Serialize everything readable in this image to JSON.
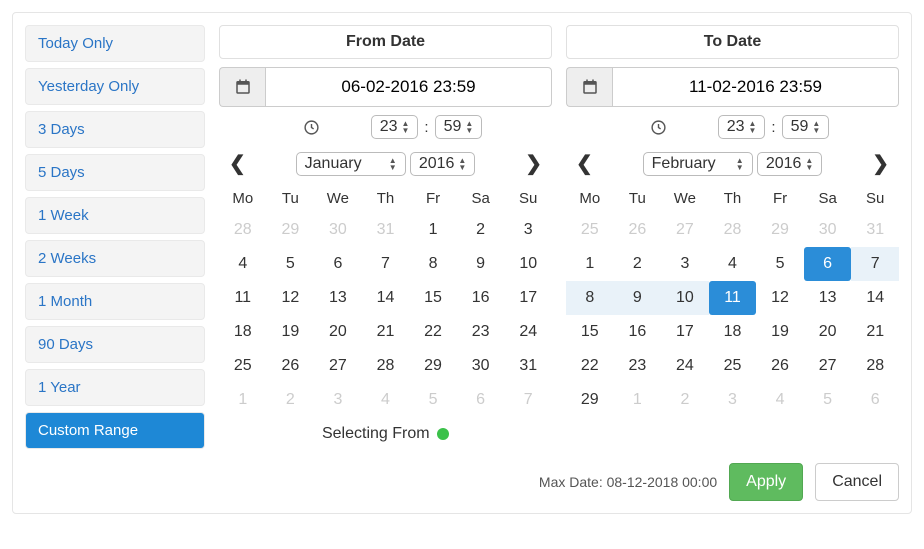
{
  "presets": [
    {
      "label": "Today Only"
    },
    {
      "label": "Yesterday Only"
    },
    {
      "label": "3 Days"
    },
    {
      "label": "5 Days"
    },
    {
      "label": "1 Week"
    },
    {
      "label": "2 Weeks"
    },
    {
      "label": "1 Month"
    },
    {
      "label": "90 Days"
    },
    {
      "label": "1 Year"
    },
    {
      "label": "Custom Range",
      "active": true
    }
  ],
  "from": {
    "title": "From Date",
    "value": "06-02-2016 23:59",
    "hour": "23",
    "minute": "59",
    "month": "January",
    "year": "2016",
    "dow": [
      "Mo",
      "Tu",
      "We",
      "Th",
      "Fr",
      "Sa",
      "Su"
    ],
    "days": [
      {
        "n": 28,
        "m": true
      },
      {
        "n": 29,
        "m": true
      },
      {
        "n": 30,
        "m": true
      },
      {
        "n": 31,
        "m": true
      },
      {
        "n": 1
      },
      {
        "n": 2
      },
      {
        "n": 3
      },
      {
        "n": 4
      },
      {
        "n": 5
      },
      {
        "n": 6
      },
      {
        "n": 7
      },
      {
        "n": 8
      },
      {
        "n": 9
      },
      {
        "n": 10
      },
      {
        "n": 11
      },
      {
        "n": 12
      },
      {
        "n": 13
      },
      {
        "n": 14
      },
      {
        "n": 15
      },
      {
        "n": 16
      },
      {
        "n": 17
      },
      {
        "n": 18
      },
      {
        "n": 19
      },
      {
        "n": 20
      },
      {
        "n": 21
      },
      {
        "n": 22
      },
      {
        "n": 23
      },
      {
        "n": 24
      },
      {
        "n": 25
      },
      {
        "n": 26
      },
      {
        "n": 27
      },
      {
        "n": 28
      },
      {
        "n": 29
      },
      {
        "n": 30
      },
      {
        "n": 31
      },
      {
        "n": 1,
        "m": true
      },
      {
        "n": 2,
        "m": true
      },
      {
        "n": 3,
        "m": true
      },
      {
        "n": 4,
        "m": true
      },
      {
        "n": 5,
        "m": true
      },
      {
        "n": 6,
        "m": true
      },
      {
        "n": 7,
        "m": true
      }
    ]
  },
  "to": {
    "title": "To Date",
    "value": "11-02-2016 23:59",
    "hour": "23",
    "minute": "59",
    "month": "February",
    "year": "2016",
    "dow": [
      "Mo",
      "Tu",
      "We",
      "Th",
      "Fr",
      "Sa",
      "Su"
    ],
    "days": [
      {
        "n": 25,
        "m": true
      },
      {
        "n": 26,
        "m": true
      },
      {
        "n": 27,
        "m": true
      },
      {
        "n": 28,
        "m": true
      },
      {
        "n": 29,
        "m": true
      },
      {
        "n": 30,
        "m": true
      },
      {
        "n": 31,
        "m": true
      },
      {
        "n": 1
      },
      {
        "n": 2
      },
      {
        "n": 3
      },
      {
        "n": 4
      },
      {
        "n": 5
      },
      {
        "n": 6,
        "sel": true
      },
      {
        "n": 7,
        "inr": true
      },
      {
        "n": 8,
        "inr": true
      },
      {
        "n": 9,
        "inr": true
      },
      {
        "n": 10,
        "inr": true
      },
      {
        "n": 11,
        "sel": true
      },
      {
        "n": 12
      },
      {
        "n": 13
      },
      {
        "n": 14
      },
      {
        "n": 15
      },
      {
        "n": 16
      },
      {
        "n": 17
      },
      {
        "n": 18
      },
      {
        "n": 19
      },
      {
        "n": 20
      },
      {
        "n": 21
      },
      {
        "n": 22
      },
      {
        "n": 23
      },
      {
        "n": 24
      },
      {
        "n": 25
      },
      {
        "n": 26
      },
      {
        "n": 27
      },
      {
        "n": 28
      },
      {
        "n": 29
      },
      {
        "n": 1,
        "m": true
      },
      {
        "n": 2,
        "m": true
      },
      {
        "n": 3,
        "m": true
      },
      {
        "n": 4,
        "m": true
      },
      {
        "n": 5,
        "m": true
      },
      {
        "n": 6,
        "m": true
      }
    ]
  },
  "selecting_label": "Selecting From",
  "maxdate_label": "Max Date: 08-12-2018 00:00",
  "apply_label": "Apply",
  "cancel_label": "Cancel",
  "colon": ":"
}
